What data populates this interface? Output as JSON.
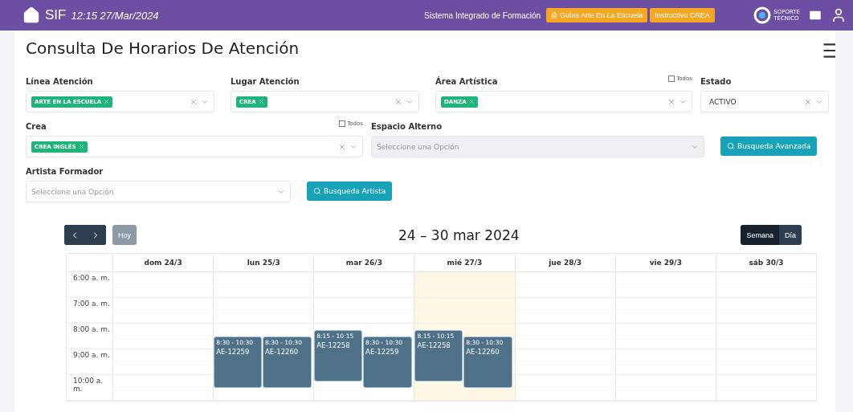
{
  "topbar": {
    "app_name": "SIF",
    "datetime": "12:15 27/Mar/2024",
    "system_name": "Sistema Integrado de Formación",
    "links": [
      {
        "label": "Guías Arte En La Escuela",
        "kind": "doc"
      },
      {
        "label": "Instructivo CREA",
        "kind": "plain"
      }
    ],
    "support": [
      "SOPORTE",
      "TÉCNICO"
    ]
  },
  "page_title": "Consulta De Horarios De Atención",
  "filter_rows": [
    {
      "fields": [
        {
          "label": "Línea Atención",
          "kind": "tags",
          "tags": [
            "ARTE EN LA ESCUELA"
          ]
        },
        {
          "label": "Lugar Atención",
          "kind": "tags",
          "tags": [
            "CREA"
          ]
        },
        {
          "label": "Área Artística",
          "kind": "tags",
          "tags": [
            "DANZA"
          ],
          "todos": {
            "label": "Todos",
            "checked": false
          }
        },
        {
          "label": "Estado",
          "kind": "value",
          "value": "ACTIVO"
        }
      ]
    },
    {
      "fields": [
        {
          "label": "Crea",
          "kind": "tags",
          "tags": [
            "CREA INGLÉS"
          ],
          "todos": {
            "label": "Todos",
            "checked": false
          }
        },
        {
          "label": "Espacio Alterno",
          "kind": "placeholder",
          "placeholder": "Seleccione una Opción",
          "disabled": true
        }
      ],
      "button": "Busqueda Avanzada"
    },
    {
      "fields": [
        {
          "label": "Artista Formador",
          "kind": "placeholder",
          "placeholder": "Seleccione una Opción",
          "disabled": false
        }
      ],
      "button": "Busqueda Artista"
    }
  ],
  "calendar": {
    "today_button": {
      "label": "Hoy",
      "disabled": true
    },
    "range_title": "24 – 30 mar 2024",
    "views": [
      {
        "label": "Semana",
        "selected": true
      },
      {
        "label": "Día",
        "selected": false
      }
    ],
    "days": [
      {
        "label": "dom 24/3",
        "today": false
      },
      {
        "label": "lun 25/3",
        "today": false,
        "events": [
          {
            "time": "8:30 - 10:30",
            "code": "AE-12259"
          },
          {
            "time": "8:30 - 10:30",
            "code": "AE-12260"
          }
        ]
      },
      {
        "label": "mar 26/3",
        "today": false,
        "events": [
          {
            "time": "8:15 - 10:15",
            "code": "AE-12258"
          },
          {
            "time": "8:30 - 10:30",
            "code": "AE-12259"
          }
        ]
      },
      {
        "label": "mié 27/3",
        "today": true,
        "events": [
          {
            "time": "8:15 - 10:15",
            "code": "AE-12258"
          },
          {
            "time": "8:30 - 10:30",
            "code": "AE-12260"
          }
        ]
      },
      {
        "label": "jue 28/3",
        "today": false
      },
      {
        "label": "vie 29/3",
        "today": false
      },
      {
        "label": "sáb 30/3",
        "today": false
      }
    ],
    "times": [
      "6:00 a. m.",
      "7:00 a. m.",
      "8:00 a. m.",
      "9:00 a. m.",
      "10:00 a. m."
    ]
  }
}
